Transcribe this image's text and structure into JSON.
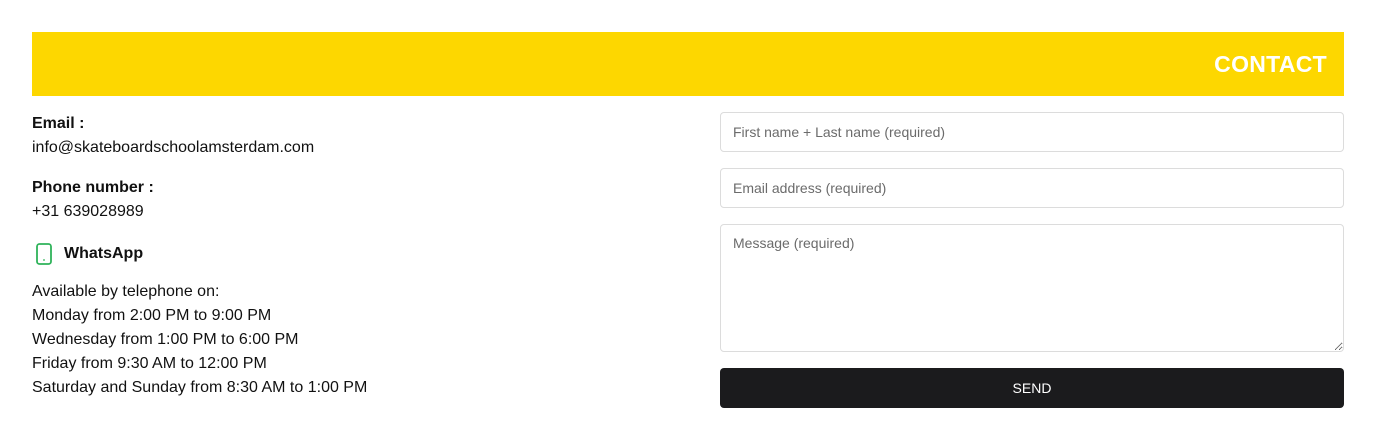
{
  "banner": {
    "title": "CONTACT"
  },
  "contact": {
    "email_label": "Email :",
    "email_value": "info@skateboardschoolamsterdam.com",
    "phone_label": "Phone number :",
    "phone_value": "+31 639028989",
    "whatsapp_label": "WhatsApp",
    "whatsapp_icon": "mobile-phone-icon",
    "hours": [
      "Available by telephone on:",
      "Monday from 2:00 PM to 9:00 PM",
      "Wednesday from 1:00 PM to 6:00 PM",
      "Friday from 9:30 AM to 12:00 PM",
      "Saturday and Sunday from 8:30 AM to 1:00 PM"
    ]
  },
  "form": {
    "name_placeholder": "First name + Last name (required)",
    "email_placeholder": "Email address (required)",
    "message_placeholder": "Message (required)",
    "send_label": "SEND"
  },
  "colors": {
    "banner": "#fdd700",
    "button": "#1b1b1d",
    "whatsapp_icon": "#2fb35a"
  }
}
